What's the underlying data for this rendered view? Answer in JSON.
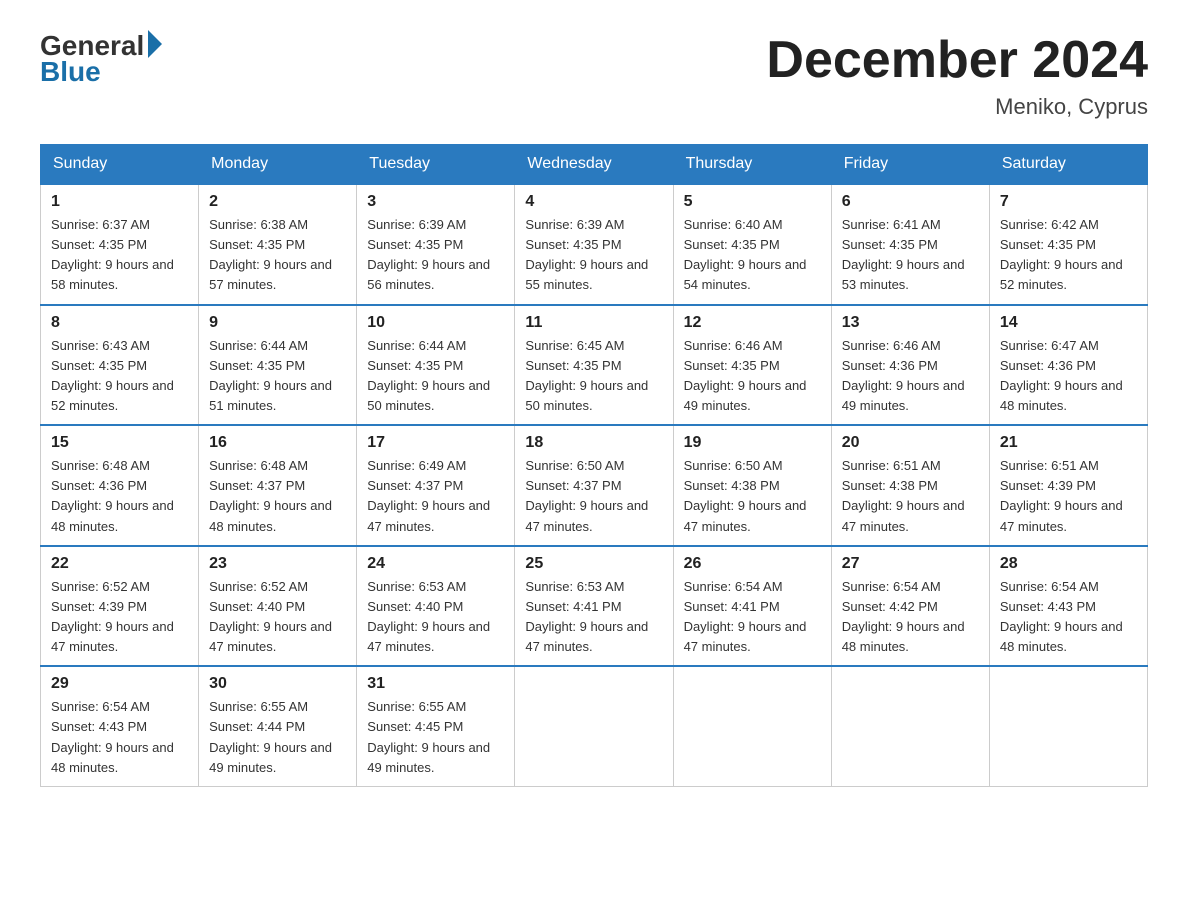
{
  "header": {
    "logo_general": "General",
    "logo_blue": "Blue",
    "title": "December 2024",
    "subtitle": "Meniko, Cyprus"
  },
  "days_of_week": [
    "Sunday",
    "Monday",
    "Tuesday",
    "Wednesday",
    "Thursday",
    "Friday",
    "Saturday"
  ],
  "weeks": [
    [
      {
        "day": "1",
        "sunrise": "6:37 AM",
        "sunset": "4:35 PM",
        "daylight": "9 hours and 58 minutes."
      },
      {
        "day": "2",
        "sunrise": "6:38 AM",
        "sunset": "4:35 PM",
        "daylight": "9 hours and 57 minutes."
      },
      {
        "day": "3",
        "sunrise": "6:39 AM",
        "sunset": "4:35 PM",
        "daylight": "9 hours and 56 minutes."
      },
      {
        "day": "4",
        "sunrise": "6:39 AM",
        "sunset": "4:35 PM",
        "daylight": "9 hours and 55 minutes."
      },
      {
        "day": "5",
        "sunrise": "6:40 AM",
        "sunset": "4:35 PM",
        "daylight": "9 hours and 54 minutes."
      },
      {
        "day": "6",
        "sunrise": "6:41 AM",
        "sunset": "4:35 PM",
        "daylight": "9 hours and 53 minutes."
      },
      {
        "day": "7",
        "sunrise": "6:42 AM",
        "sunset": "4:35 PM",
        "daylight": "9 hours and 52 minutes."
      }
    ],
    [
      {
        "day": "8",
        "sunrise": "6:43 AM",
        "sunset": "4:35 PM",
        "daylight": "9 hours and 52 minutes."
      },
      {
        "day": "9",
        "sunrise": "6:44 AM",
        "sunset": "4:35 PM",
        "daylight": "9 hours and 51 minutes."
      },
      {
        "day": "10",
        "sunrise": "6:44 AM",
        "sunset": "4:35 PM",
        "daylight": "9 hours and 50 minutes."
      },
      {
        "day": "11",
        "sunrise": "6:45 AM",
        "sunset": "4:35 PM",
        "daylight": "9 hours and 50 minutes."
      },
      {
        "day": "12",
        "sunrise": "6:46 AM",
        "sunset": "4:35 PM",
        "daylight": "9 hours and 49 minutes."
      },
      {
        "day": "13",
        "sunrise": "6:46 AM",
        "sunset": "4:36 PM",
        "daylight": "9 hours and 49 minutes."
      },
      {
        "day": "14",
        "sunrise": "6:47 AM",
        "sunset": "4:36 PM",
        "daylight": "9 hours and 48 minutes."
      }
    ],
    [
      {
        "day": "15",
        "sunrise": "6:48 AM",
        "sunset": "4:36 PM",
        "daylight": "9 hours and 48 minutes."
      },
      {
        "day": "16",
        "sunrise": "6:48 AM",
        "sunset": "4:37 PM",
        "daylight": "9 hours and 48 minutes."
      },
      {
        "day": "17",
        "sunrise": "6:49 AM",
        "sunset": "4:37 PM",
        "daylight": "9 hours and 47 minutes."
      },
      {
        "day": "18",
        "sunrise": "6:50 AM",
        "sunset": "4:37 PM",
        "daylight": "9 hours and 47 minutes."
      },
      {
        "day": "19",
        "sunrise": "6:50 AM",
        "sunset": "4:38 PM",
        "daylight": "9 hours and 47 minutes."
      },
      {
        "day": "20",
        "sunrise": "6:51 AM",
        "sunset": "4:38 PM",
        "daylight": "9 hours and 47 minutes."
      },
      {
        "day": "21",
        "sunrise": "6:51 AM",
        "sunset": "4:39 PM",
        "daylight": "9 hours and 47 minutes."
      }
    ],
    [
      {
        "day": "22",
        "sunrise": "6:52 AM",
        "sunset": "4:39 PM",
        "daylight": "9 hours and 47 minutes."
      },
      {
        "day": "23",
        "sunrise": "6:52 AM",
        "sunset": "4:40 PM",
        "daylight": "9 hours and 47 minutes."
      },
      {
        "day": "24",
        "sunrise": "6:53 AM",
        "sunset": "4:40 PM",
        "daylight": "9 hours and 47 minutes."
      },
      {
        "day": "25",
        "sunrise": "6:53 AM",
        "sunset": "4:41 PM",
        "daylight": "9 hours and 47 minutes."
      },
      {
        "day": "26",
        "sunrise": "6:54 AM",
        "sunset": "4:41 PM",
        "daylight": "9 hours and 47 minutes."
      },
      {
        "day": "27",
        "sunrise": "6:54 AM",
        "sunset": "4:42 PM",
        "daylight": "9 hours and 48 minutes."
      },
      {
        "day": "28",
        "sunrise": "6:54 AM",
        "sunset": "4:43 PM",
        "daylight": "9 hours and 48 minutes."
      }
    ],
    [
      {
        "day": "29",
        "sunrise": "6:54 AM",
        "sunset": "4:43 PM",
        "daylight": "9 hours and 48 minutes."
      },
      {
        "day": "30",
        "sunrise": "6:55 AM",
        "sunset": "4:44 PM",
        "daylight": "9 hours and 49 minutes."
      },
      {
        "day": "31",
        "sunrise": "6:55 AM",
        "sunset": "4:45 PM",
        "daylight": "9 hours and 49 minutes."
      },
      null,
      null,
      null,
      null
    ]
  ],
  "labels": {
    "sunrise_prefix": "Sunrise: ",
    "sunset_prefix": "Sunset: ",
    "daylight_prefix": "Daylight: "
  }
}
